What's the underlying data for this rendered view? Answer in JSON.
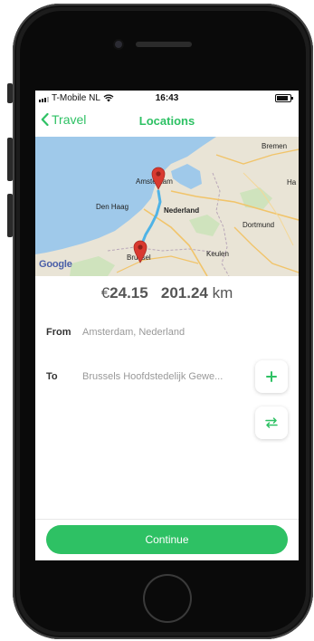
{
  "status": {
    "carrier": "T-Mobile NL",
    "time": "16:43",
    "battery_level": 0.85
  },
  "nav": {
    "back_label": "Travel",
    "title": "Locations"
  },
  "map": {
    "labels": {
      "bremen": "Bremen",
      "amsterdam": "Amsterdam",
      "ha": "Ha",
      "den_haag": "Den Haag",
      "nederland": "Nederland",
      "dortmund": "Dortmund",
      "keulen": "Keulen",
      "brussel": "Brussel"
    },
    "provider": "Google"
  },
  "summary": {
    "currency": "€",
    "cost": "24.15",
    "distance": "201.24",
    "distance_unit": "km"
  },
  "route": {
    "from_label": "From",
    "from_value": "Amsterdam, Nederland",
    "to_label": "To",
    "to_value": "Brussels Hoofdstedelijk Gewe..."
  },
  "actions": {
    "add_icon": "plus-icon",
    "swap_icon": "swap-icon",
    "continue_label": "Continue"
  },
  "colors": {
    "accent": "#2ec164",
    "water": "#9fc9ea",
    "land": "#e9e4d6",
    "route": "#4fb3e6",
    "pin": "#d93a30"
  }
}
